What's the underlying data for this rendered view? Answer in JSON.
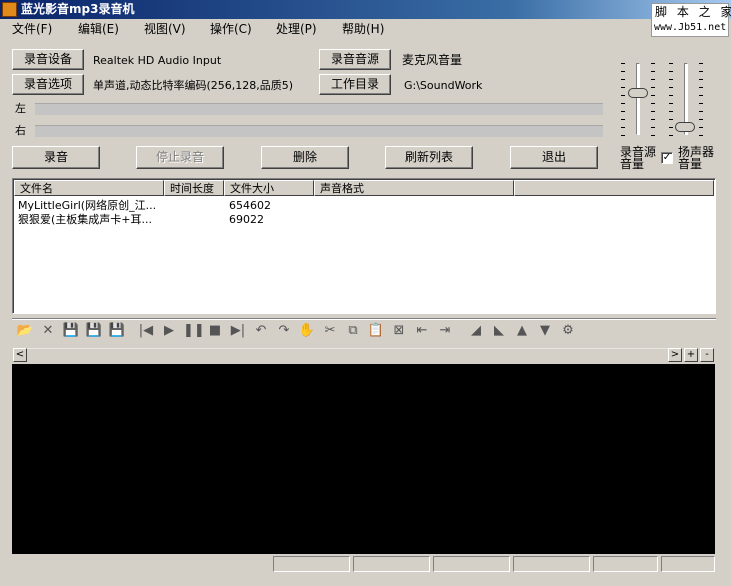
{
  "window": {
    "title": "蓝光影音mp3录音机"
  },
  "watermark": {
    "chars": "脚 本 之 家",
    "url": "www.Jb51.net"
  },
  "menu": [
    "文件(F)",
    "编辑(E)",
    "视图(V)",
    "操作(C)",
    "处理(P)",
    "帮助(H)"
  ],
  "controls": {
    "device_button": "录音设备",
    "device_value": "Realtek HD Audio Input",
    "source_button": "录音音源",
    "source_value": "麦克风音量",
    "options_button": "录音选项",
    "options_value": "单声道,动态比特率编码(256,128,品质5)",
    "workdir_button": "工作目录",
    "workdir_value": "G:\\SoundWork",
    "left_label": "左",
    "right_label": "右"
  },
  "actions": {
    "record": "录音",
    "stop": "停止录音",
    "delete": "删除",
    "refresh": "刷新列表",
    "exit": "退出"
  },
  "sliders": {
    "source_label_1": "录音源",
    "source_label_2": "音量",
    "source_level": 0.6,
    "speaker_label_1": "扬声器",
    "speaker_label_2": "音量",
    "speaker_level": 0.05,
    "speaker_checked": true,
    "check_mark": "✓"
  },
  "table": {
    "columns": [
      "文件名",
      "时间长度",
      "文件大小",
      "声音格式"
    ],
    "rows": [
      [
        "MyLittleGirl(网络原创_江...",
        "",
        "654602",
        ""
      ],
      [
        "狠狠爱(主板集成声卡+耳...",
        "",
        "69022",
        ""
      ]
    ]
  },
  "toolbar": {
    "icons": [
      "open-icon",
      "new-icon",
      "save-icon",
      "save-as-icon",
      "export-icon",
      "skip-back-icon",
      "play-icon",
      "pause-icon",
      "stop-icon",
      "skip-forward-icon",
      "undo-icon",
      "redo-icon",
      "hand-icon",
      "cut-icon",
      "copy-icon",
      "paste-icon",
      "mix-icon",
      "trim-icon",
      "expand-icon",
      "fade-in-icon",
      "fade-out-icon",
      "volume-up-icon",
      "volume-down-icon",
      "effect-icon"
    ],
    "glyphs": [
      "📂",
      "✕",
      "💾",
      "💾",
      "💾",
      "|◀",
      "▶",
      "❚❚",
      "■",
      "▶|",
      "↶",
      "↷",
      "✋",
      "✂",
      "⧉",
      "📋",
      "⊠",
      "⇤",
      "⇥",
      "◢",
      "◣",
      "▲",
      "▼",
      "⚙"
    ]
  },
  "scroll": {
    "left": "<",
    "right": ">",
    "plus": "+",
    "minus": "-"
  }
}
